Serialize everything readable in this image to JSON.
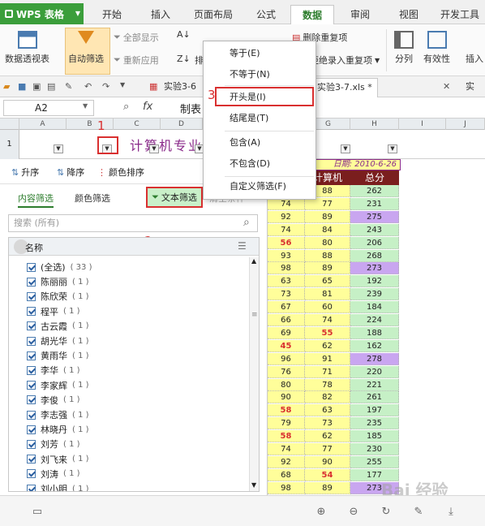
{
  "app": {
    "name": "WPS 表格",
    "tabs": [
      "开始",
      "插入",
      "页面布局",
      "公式",
      "数据",
      "审阅",
      "视图",
      "开发工具"
    ],
    "active_tab": "数据"
  },
  "ribbon": {
    "pivot_table": "数据透视表",
    "auto_filter": "自动筛选",
    "show_all": "全部显示",
    "reapply": "重新应用",
    "sort_label": "排",
    "delete_dup": "删除重复项",
    "reject_dup": "拒绝录入重复项",
    "split": "分列",
    "validity": "有效性",
    "insert": "插入"
  },
  "doc_tabs": [
    "实验3-6",
    "实验3-7.xls *",
    "实"
  ],
  "formula_bar": {
    "cell_ref": "A2",
    "fx": "fx",
    "content": "制表"
  },
  "columns": [
    "A",
    "B",
    "C",
    "D",
    "E",
    "F",
    "G",
    "H",
    "I",
    "J"
  ],
  "row1": {
    "row_num": "1",
    "title": "计算机专业"
  },
  "filter_panel": {
    "sort_asc": "升序",
    "sort_desc": "降序",
    "color_sort": "颜色排序",
    "tab_content": "内容筛选",
    "tab_color": "颜色筛选",
    "tab_text": "文本筛选",
    "clear": "清空条件",
    "search_placeholder": "搜索 (所有)",
    "list_header": "名称",
    "items": [
      {
        "name": "(全选)",
        "count": "( 33 )"
      },
      {
        "name": "陈丽丽",
        "count": "( 1 )"
      },
      {
        "name": "陈欣荣",
        "count": "( 1 )"
      },
      {
        "name": "程平",
        "count": "( 1 )"
      },
      {
        "name": "古云霞",
        "count": "( 1 )"
      },
      {
        "name": "胡光华",
        "count": "( 1 )"
      },
      {
        "name": "黄雨华",
        "count": "( 1 )"
      },
      {
        "name": "李华",
        "count": "( 1 )"
      },
      {
        "name": "李家辉",
        "count": "( 1 )"
      },
      {
        "name": "李俊",
        "count": "( 1 )"
      },
      {
        "name": "李志强",
        "count": "( 1 )"
      },
      {
        "name": "林晓丹",
        "count": "( 1 )"
      },
      {
        "name": "刘芳",
        "count": "( 1 )"
      },
      {
        "name": "刘飞来",
        "count": "( 1 )"
      },
      {
        "name": "刘涛",
        "count": "( 1 )"
      },
      {
        "name": "刘小明",
        "count": "( 1 )"
      }
    ]
  },
  "sheet": {
    "date_label": "日期: 2010-6-26",
    "header_computer": "计算机",
    "header_total": "总分",
    "rows": [
      [
        "7",
        "88",
        "262"
      ],
      [
        "74",
        "77",
        "231"
      ],
      [
        "92",
        "89",
        "275"
      ],
      [
        "74",
        "84",
        "243"
      ],
      [
        "56",
        "80",
        "206"
      ],
      [
        "93",
        "88",
        "268"
      ],
      [
        "98",
        "89",
        "273"
      ],
      [
        "63",
        "65",
        "192"
      ],
      [
        "73",
        "81",
        "239"
      ],
      [
        "67",
        "60",
        "184"
      ],
      [
        "66",
        "74",
        "224"
      ],
      [
        "69",
        "55",
        "188"
      ],
      [
        "45",
        "62",
        "162"
      ],
      [
        "96",
        "91",
        "278"
      ],
      [
        "76",
        "71",
        "220"
      ],
      [
        "80",
        "78",
        "221"
      ],
      [
        "90",
        "82",
        "261"
      ],
      [
        "58",
        "63",
        "197"
      ],
      [
        "79",
        "73",
        "235"
      ],
      [
        "58",
        "62",
        "185"
      ],
      [
        "74",
        "77",
        "230"
      ],
      [
        "92",
        "90",
        "255"
      ],
      [
        "68",
        "54",
        "177"
      ],
      [
        "98",
        "89",
        "273"
      ]
    ]
  },
  "text_filter_menu": {
    "items": [
      "等于(E)",
      "不等于(N)",
      "开头是(I)",
      "结尾是(T)",
      "包含(A)",
      "不包含(D)",
      "自定义筛选(F)"
    ]
  },
  "annotations": [
    "1",
    "2",
    "3"
  ],
  "watermark": "Bai 经验",
  "colors": {
    "accent": "#3b9e3b",
    "highlight_red": "#d93030",
    "header_dark": "#7a1e1e",
    "cell_yellow": "#fffe9a",
    "cell_green": "#c6f0c6",
    "cell_purple": "#c9a6f0"
  }
}
